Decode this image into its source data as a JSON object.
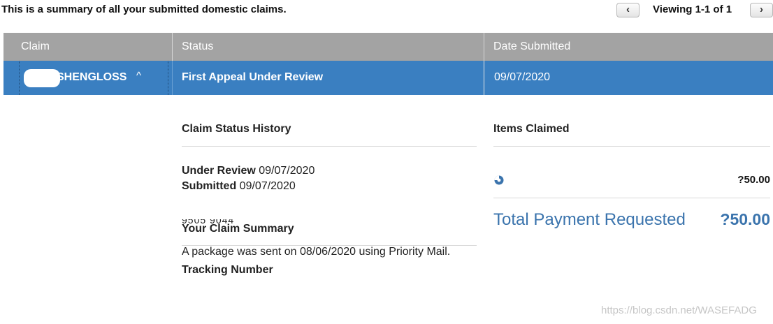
{
  "header": {
    "summary": "This is a summary of all your submitted domestic claims.",
    "viewing": "Viewing 1-1 of 1",
    "prev_glyph": "‹",
    "next_glyph": "›"
  },
  "table": {
    "columns": [
      "Claim",
      "Status",
      "Date Submitted"
    ],
    "row": {
      "claim": "SHENGLOSS",
      "status": "First Appeal Under Review",
      "date": "09/07/2020",
      "expand_glyph": "^"
    }
  },
  "details": {
    "history_title": "Claim Status History",
    "history": [
      {
        "label": "Under Review",
        "date": "09/07/2020"
      },
      {
        "label": "Submitted",
        "date": "09/07/2020"
      }
    ],
    "summary_title": "Your Claim Summary",
    "tracking_label": "Tracking Number",
    "tracking_number": "9505 9044",
    "package_note": "A package was sent on 08/06/2020 using Priority Mail.",
    "items_title": "Items Claimed",
    "item_amount": "?50.00",
    "item_icon": "loading-icon",
    "total_label": "Total Payment Requested",
    "total_amount": "?50.00"
  },
  "watermark": "https://blog.csdn.net/WASEFADG",
  "colors": {
    "header_gray": "#a3a3a3",
    "row_blue": "#3a7fc1",
    "total_blue": "#3b74ad"
  }
}
